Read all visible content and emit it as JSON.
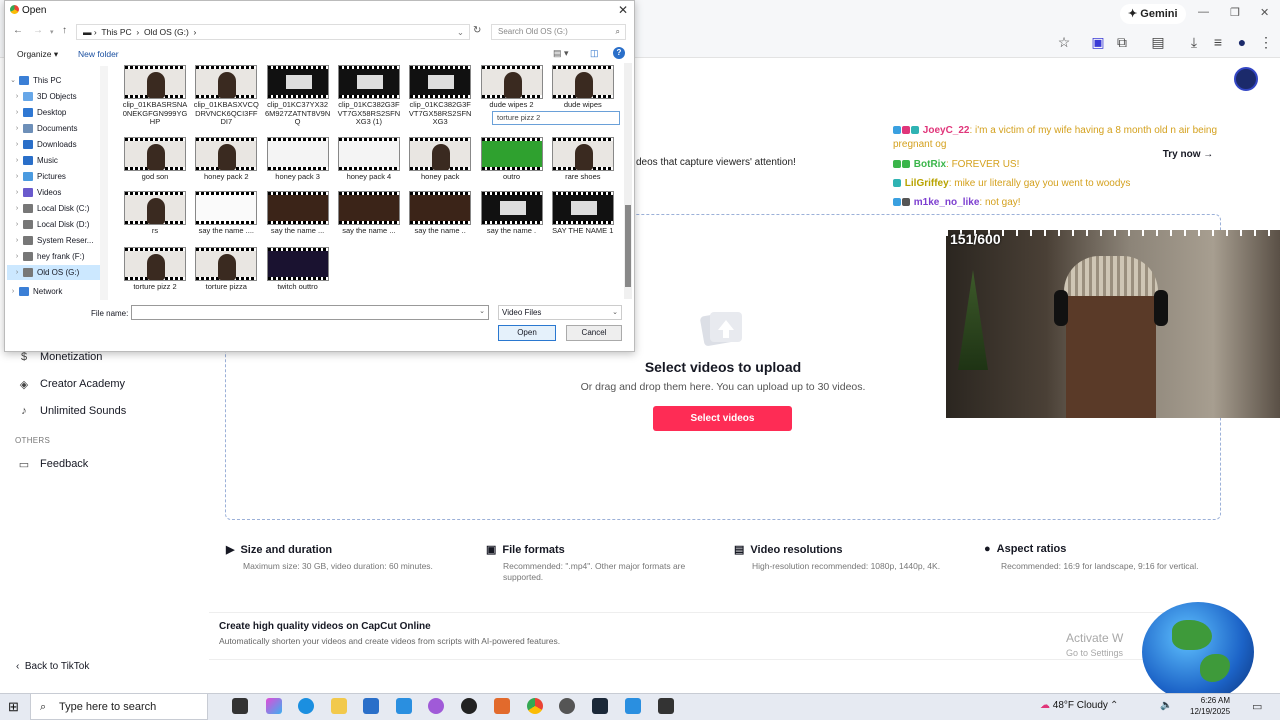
{
  "browser": {
    "gemini_label": "Gemini",
    "avatar_color": "#1b2a6b"
  },
  "sidebar": {
    "items": [
      {
        "label": "Monetization",
        "icon": "dollar-icon"
      },
      {
        "label": "Creator Academy",
        "icon": "academy-icon"
      },
      {
        "label": "Unlimited Sounds",
        "icon": "music-note-icon"
      }
    ],
    "others_label": "OTHERS",
    "feedback_label": "Feedback",
    "back_label": "Back to TikTok"
  },
  "banner": {
    "text": "deos that capture viewers' attention!",
    "try_now": "Try now →"
  },
  "upload": {
    "title": "Select videos to upload",
    "subtitle": "Or drag and drop them here. You can upload up to 30 videos.",
    "button": "Select videos",
    "accent_color": "#fe2c55"
  },
  "features": [
    {
      "title": "Size and duration",
      "desc": "Maximum size: 30 GB, video duration: 60 minutes.",
      "icon": "video-camera-icon"
    },
    {
      "title": "File formats",
      "desc": "Recommended: \".mp4\". Other major formats are supported.",
      "icon": "file-icon"
    },
    {
      "title": "Video resolutions",
      "desc": "High-resolution recommended: 1080p, 1440p, 4K.",
      "icon": "hd-icon"
    },
    {
      "title": "Aspect ratios",
      "desc": "Recommended: 16:9 for landscape, 9:16 for vertical.",
      "icon": "pin-icon"
    }
  ],
  "capcut": {
    "title": "Create high quality videos on CapCut Online",
    "subtitle": "Automatically shorten your videos and create videos from scripts with AI-powered features."
  },
  "activate": {
    "line1": "Activate W",
    "line2": "Go to Settings"
  },
  "chat": [
    {
      "user": "JoeyC_22",
      "text": ": i'm a victim of my wife having a 8 month old n air being pregnant og",
      "color": "#e0357a"
    },
    {
      "user": "BotRix",
      "text": ": FOREVER US!",
      "color": "#3ab54a"
    },
    {
      "user": "LilGriffey",
      "text": ": mike ur literally gay you went to woodys",
      "color": "#b8a300"
    },
    {
      "user": "m1ke_no_like",
      "text": ": not gay!",
      "color": "#7d3fd0"
    }
  ],
  "webcam": {
    "counter": "151/600"
  },
  "dialog": {
    "title": "Open",
    "path": [
      "This PC",
      "Old OS (G:)"
    ],
    "search_placeholder": "Search Old OS (G:)",
    "organize": "Organize ▾",
    "new_folder": "New folder",
    "tree": [
      {
        "label": "This PC",
        "color": "#3b7fd6",
        "expanded": true
      },
      {
        "label": "3D Objects",
        "color": "#67a7e8"
      },
      {
        "label": "Desktop",
        "color": "#2f78d3"
      },
      {
        "label": "Documents",
        "color": "#6d8fb8"
      },
      {
        "label": "Downloads",
        "color": "#2a6fc9"
      },
      {
        "label": "Music",
        "color": "#2a6fc9"
      },
      {
        "label": "Pictures",
        "color": "#4b9be0"
      },
      {
        "label": "Videos",
        "color": "#6a5acd"
      },
      {
        "label": "Local Disk (C:)",
        "color": "#777"
      },
      {
        "label": "Local Disk (D:)",
        "color": "#777"
      },
      {
        "label": "System Reser...",
        "color": "#777"
      },
      {
        "label": "hey frank (F:)",
        "color": "#777"
      },
      {
        "label": "Old OS (G:)",
        "color": "#777",
        "selected": true
      },
      {
        "label": "Network",
        "color": "#3b7fd6"
      }
    ],
    "files": [
      {
        "name": "clip_01KBASRSNA0NEKGFGN999YGHP",
        "thumb": "person"
      },
      {
        "name": "clip_01KBASXVCQDRVNCK6QCI3FFDI7",
        "thumb": "person"
      },
      {
        "name": "clip_01KC37YX32 6M927ZATNT8V9NQ",
        "thumb": "screen"
      },
      {
        "name": "clip_01KC382G3F VT7GX58RS2SFNXG3 (1)",
        "thumb": "screen"
      },
      {
        "name": "clip_01KC382G3F VT7GX58RS2SFNXG3",
        "thumb": "screen"
      },
      {
        "name": "dude wipes 2",
        "thumb": "person"
      },
      {
        "name": "dude wipes",
        "thumb": "person"
      },
      {
        "name": "god son",
        "thumb": "person"
      },
      {
        "name": "honey pack 2",
        "thumb": "person"
      },
      {
        "name": "honey pack 3",
        "thumb": "doc"
      },
      {
        "name": "honey pack 4",
        "thumb": "doc"
      },
      {
        "name": "honey pack",
        "thumb": "person"
      },
      {
        "name": "outro",
        "thumb": "green"
      },
      {
        "name": "rare shoes",
        "thumb": "person"
      },
      {
        "name": "rs",
        "thumb": "person"
      },
      {
        "name": "say the name ....",
        "thumb": "white"
      },
      {
        "name": "say the name ...",
        "thumb": "brown"
      },
      {
        "name": "say the name ...",
        "thumb": "brown"
      },
      {
        "name": "say the name ..",
        "thumb": "brown"
      },
      {
        "name": "say the name .",
        "thumb": "screen"
      },
      {
        "name": "SAY THE NAME 1",
        "thumb": "screen"
      },
      {
        "name": "torture pizz 2",
        "thumb": "person"
      },
      {
        "name": "torture pizza",
        "thumb": "person"
      },
      {
        "name": "twitch outtro",
        "thumb": "purple"
      }
    ],
    "rename_value": "torture pizz 2",
    "file_name_label": "File name:",
    "file_name_value": "",
    "filter": "Video Files",
    "open_label": "Open",
    "cancel_label": "Cancel"
  },
  "taskbar": {
    "search_placeholder": "Type here to search",
    "weather": "48°F  Cloudy",
    "time": "6:26 AM",
    "date": "12/19/2025"
  }
}
